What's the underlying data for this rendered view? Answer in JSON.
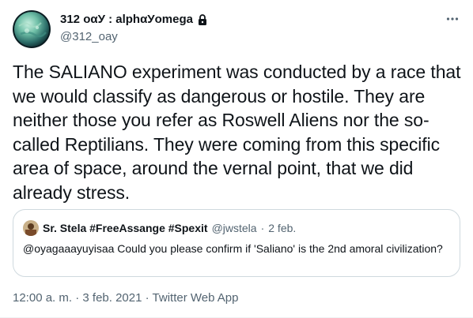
{
  "author": {
    "display_name": "312 οαУ : alphαУomega",
    "handle": "@312_oay",
    "verified_protected_icon": "lock-icon",
    "avatar_icon": "planet-avatar"
  },
  "more_icon": "more-dots-icon",
  "tweet": {
    "text": "The SALIANO experiment was conducted by a race that we would classify as dangerous or hostile. They are neither those you refer as Roswell Aliens nor the so-called Reptilians. They were coming from this specific area of space, around the vernal point, that we did already stress."
  },
  "quoted": {
    "display_name": "Sr. Stela #FreeAssange #Spexit",
    "handle": "@jwstela",
    "separator": "·",
    "date": "2 feb.",
    "text": "@oyagaaayuyisaa Could you please confirm if 'Saliano' is the 2nd amoral civilization?"
  },
  "meta": {
    "time": "12:00 a. m.",
    "sep1": " · ",
    "date": "3 feb. 2021",
    "sep2": " · ",
    "source": "Twitter Web App"
  },
  "colors": {
    "text": "#0f1419",
    "secondary": "#536471",
    "border": "#cfd9de"
  }
}
